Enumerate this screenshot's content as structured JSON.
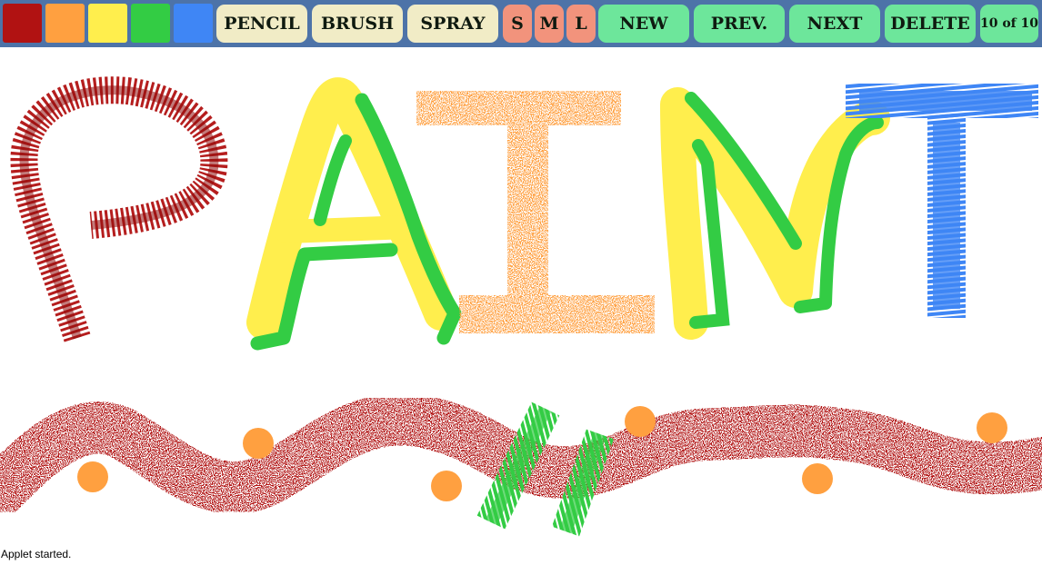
{
  "palette": {
    "colors": [
      "#b11212",
      "#ffa040",
      "#ffee4d",
      "#33cc44",
      "#3f86f5"
    ],
    "names": [
      "red",
      "orange",
      "yellow",
      "green",
      "blue"
    ]
  },
  "toolbar": {
    "pencil_label": "PENCIL",
    "brush_label": "BRUSH",
    "spray_label": "SPRAY",
    "size_small_label": "S",
    "size_medium_label": "M",
    "size_large_label": "L",
    "new_label": "NEW",
    "prev_label": "PREV.",
    "next_label": "NEXT",
    "delete_label": "DELETE",
    "page_counter": "10 of 10",
    "colors": {
      "toolbar_bg": "#4d73a8",
      "tool_btn": "#f1ecc6",
      "size_btn": "#f2937c",
      "nav_btn": "#6de69b"
    }
  },
  "status": {
    "text": "Applet started."
  }
}
